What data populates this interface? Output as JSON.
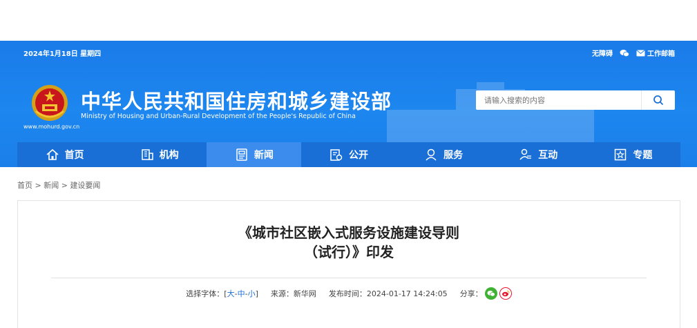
{
  "topbar": {
    "date": "2024年1月18日 星期四",
    "accessibility_label": "无障碍",
    "email_label": "工作邮箱"
  },
  "header": {
    "title": "中华人民共和国住房和城乡建设部",
    "subtitle": "Ministry of Housing and Urban-Rural Development of the People's Republic of China",
    "url": "www.mohurd.gov.cn"
  },
  "search": {
    "placeholder": "请输入搜索的内容",
    "icon": "search-icon"
  },
  "nav": {
    "items": [
      {
        "label": "首页",
        "icon": "home-icon"
      },
      {
        "label": "机构",
        "icon": "building-icon"
      },
      {
        "label": "新闻",
        "icon": "news-icon",
        "active": true
      },
      {
        "label": "公开",
        "icon": "disclosure-icon"
      },
      {
        "label": "服务",
        "icon": "service-icon"
      },
      {
        "label": "互动",
        "icon": "interaction-icon"
      },
      {
        "label": "专题",
        "icon": "topic-icon"
      }
    ]
  },
  "breadcrumb": {
    "items": [
      "首页",
      "新闻",
      "建设要闻"
    ],
    "separator": ">"
  },
  "article": {
    "title_line1": "《城市社区嵌入式服务设施建设导则",
    "title_line2": "（试行）》印发",
    "font_label": "选择字体：",
    "font_open": "[",
    "font_large": "大",
    "font_medium": "中",
    "font_small": "小",
    "font_sep": "-",
    "font_close": "]",
    "source": "来源：新华网",
    "publish_time": "发布时间：2024-01-17 14:24:05",
    "share_label": "分享："
  },
  "colors": {
    "banner": "#1d86ef",
    "nav": "#1a6fd6",
    "nav_active": "#3b8cec",
    "wechat": "#3fb233",
    "weibo": "#e6162d"
  }
}
